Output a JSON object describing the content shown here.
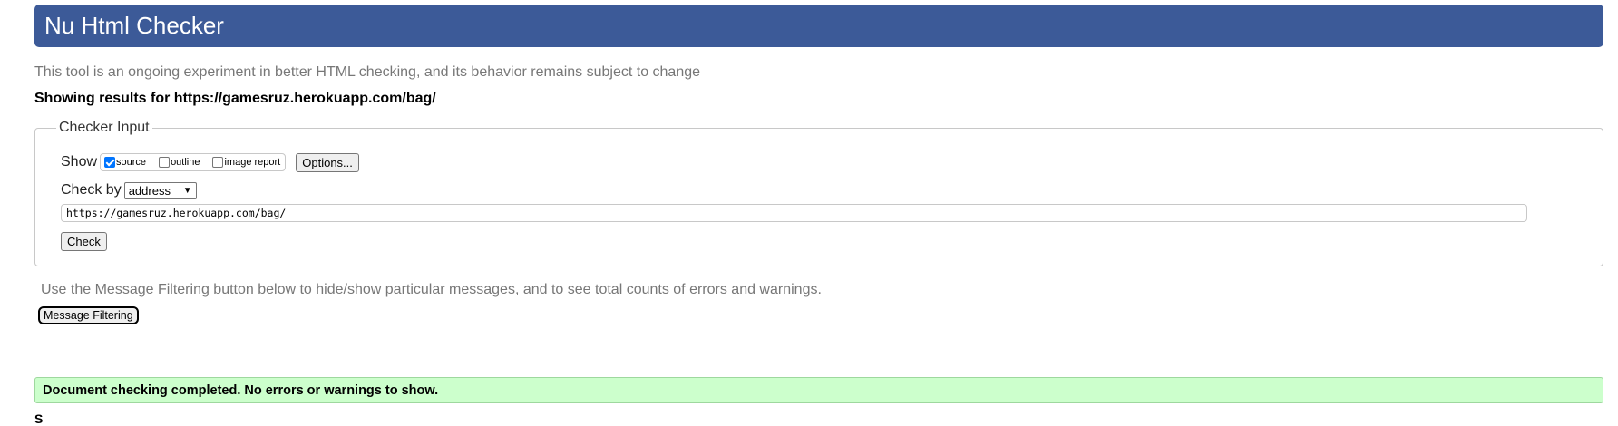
{
  "header": {
    "title": "Nu Html Checker"
  },
  "intro_text": "This tool is an ongoing experiment in better HTML checking, and its behavior remains subject to change",
  "showing_results": "Showing results for https://gamesruz.herokuapp.com/bag/",
  "checker_input": {
    "legend": "Checker Input",
    "show_label": "Show",
    "show_options": [
      {
        "label": "source",
        "checked": true
      },
      {
        "label": "outline",
        "checked": false
      },
      {
        "label": "image report",
        "checked": false
      }
    ],
    "options_button": "Options...",
    "check_by_label": "Check by",
    "check_by_value": "address",
    "url_value": "https://gamesruz.herokuapp.com/bag/",
    "check_button": "Check"
  },
  "filter_note": "Use the Message Filtering button below to hide/show particular messages, and to see total counts of errors and warnings.",
  "filter_button": "Message Filtering",
  "result_message": "Document checking completed. No errors or warnings to show.",
  "colors": {
    "header_bg": "#3c5a98",
    "success_bg": "#ccffcc",
    "muted_text": "#777777"
  }
}
